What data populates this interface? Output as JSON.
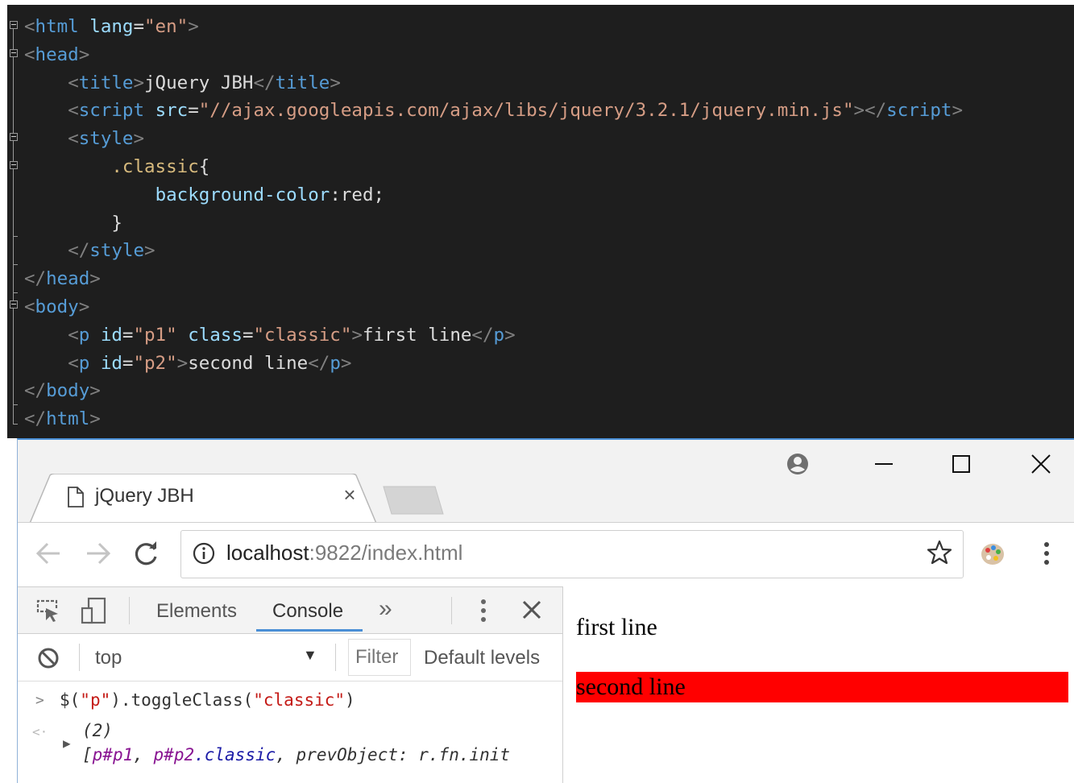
{
  "editor": {
    "lines": [
      [
        [
          "<",
          "b"
        ],
        [
          "html ",
          "t"
        ],
        [
          "lang",
          "a"
        ],
        [
          "=",
          "p"
        ],
        [
          "\"en\"",
          "s"
        ],
        [
          ">",
          "b"
        ]
      ],
      [
        [
          "<",
          "b"
        ],
        [
          "head",
          "t"
        ],
        [
          ">",
          "b"
        ]
      ],
      [
        [
          "    ",
          "p"
        ],
        [
          "<",
          "b"
        ],
        [
          "title",
          "t"
        ],
        [
          ">",
          "b"
        ],
        [
          "jQuery JBH",
          "p"
        ],
        [
          "</",
          "b"
        ],
        [
          "title",
          "t"
        ],
        [
          ">",
          "b"
        ]
      ],
      [
        [
          "    ",
          "p"
        ],
        [
          "<",
          "b"
        ],
        [
          "script ",
          "t"
        ],
        [
          "src",
          "a"
        ],
        [
          "=",
          "p"
        ],
        [
          "\"//ajax.googleapis.com/ajax/libs/jquery/3.2.1/jquery.min.js\"",
          "s"
        ],
        [
          ">",
          "b"
        ],
        [
          "</",
          "b"
        ],
        [
          "script",
          "t"
        ],
        [
          ">",
          "b"
        ]
      ],
      [
        [
          "    ",
          "p"
        ],
        [
          "<",
          "b"
        ],
        [
          "style",
          "t"
        ],
        [
          ">",
          "b"
        ]
      ],
      [
        [
          "        ",
          "p"
        ],
        [
          ".classic",
          "sel"
        ],
        [
          "{",
          "p"
        ]
      ],
      [
        [
          "            ",
          "p"
        ],
        [
          "background-color",
          "a"
        ],
        [
          ":",
          "p"
        ],
        [
          "red",
          "p"
        ],
        [
          ";",
          "p"
        ]
      ],
      [
        [
          "        ",
          "p"
        ],
        [
          "}",
          "p"
        ]
      ],
      [
        [
          "    ",
          "p"
        ],
        [
          "</",
          "b"
        ],
        [
          "style",
          "t"
        ],
        [
          ">",
          "b"
        ]
      ],
      [
        [
          "</",
          "b"
        ],
        [
          "head",
          "t"
        ],
        [
          ">",
          "b"
        ]
      ],
      [
        [
          "<",
          "b"
        ],
        [
          "body",
          "t"
        ],
        [
          ">",
          "b"
        ]
      ],
      [
        [
          "    ",
          "p"
        ],
        [
          "<",
          "b"
        ],
        [
          "p ",
          "t"
        ],
        [
          "id",
          "a"
        ],
        [
          "=",
          "p"
        ],
        [
          "\"p1\" ",
          "s"
        ],
        [
          "class",
          "a"
        ],
        [
          "=",
          "p"
        ],
        [
          "\"classic\"",
          "s"
        ],
        [
          ">",
          "b"
        ],
        [
          "first line",
          "p"
        ],
        [
          "</",
          "b"
        ],
        [
          "p",
          "t"
        ],
        [
          ">",
          "b"
        ]
      ],
      [
        [
          "    ",
          "p"
        ],
        [
          "<",
          "b"
        ],
        [
          "p ",
          "t"
        ],
        [
          "id",
          "a"
        ],
        [
          "=",
          "p"
        ],
        [
          "\"p2\"",
          "s"
        ],
        [
          ">",
          "b"
        ],
        [
          "second line",
          "p"
        ],
        [
          "</",
          "b"
        ],
        [
          "p",
          "t"
        ],
        [
          ">",
          "b"
        ]
      ],
      [
        [
          "</",
          "b"
        ],
        [
          "body",
          "t"
        ],
        [
          ">",
          "b"
        ]
      ],
      [
        [
          "</",
          "b"
        ],
        [
          "html",
          "t"
        ],
        [
          ">",
          "b"
        ]
      ]
    ]
  },
  "browser": {
    "tab_title": "jQuery JBH",
    "url_host": "localhost",
    "url_rest": ":9822/index.html"
  },
  "devtools": {
    "tabs": [
      "Elements",
      "Console"
    ],
    "active_tab": "Console",
    "more_tabs": "»",
    "context": "top",
    "filter_placeholder": "Filter",
    "levels": "Default levels",
    "command": {
      "prompt": ">",
      "segments": [
        [
          "$(",
          "plain"
        ],
        [
          "\"p\"",
          "str"
        ],
        [
          ").toggleClass(",
          "plain"
        ],
        [
          "\"classic\"",
          "str"
        ],
        [
          ")",
          "plain"
        ]
      ]
    },
    "result": {
      "arrow": "<·",
      "count": "(2)",
      "segments": [
        [
          "[",
          "it"
        ],
        [
          "p#p1",
          "it-p"
        ],
        [
          ", ",
          "it"
        ],
        [
          "p#p2",
          "it-p"
        ],
        [
          ".classic",
          "it-c"
        ],
        [
          ", prevObject: r.fn.init",
          "it"
        ]
      ]
    }
  },
  "page": {
    "p1": "first line",
    "p2": "second line",
    "highlight_color": "#ff0000"
  },
  "icons": [
    "page-icon",
    "close-icon",
    "back-arrow-icon",
    "forward-arrow-icon",
    "reload-icon",
    "info-icon",
    "star-icon",
    "extension-icon",
    "menu-icon",
    "account-icon",
    "minimize-icon",
    "maximize-icon",
    "inspect-icon",
    "device-icon",
    "more-icon",
    "block-icon"
  ]
}
